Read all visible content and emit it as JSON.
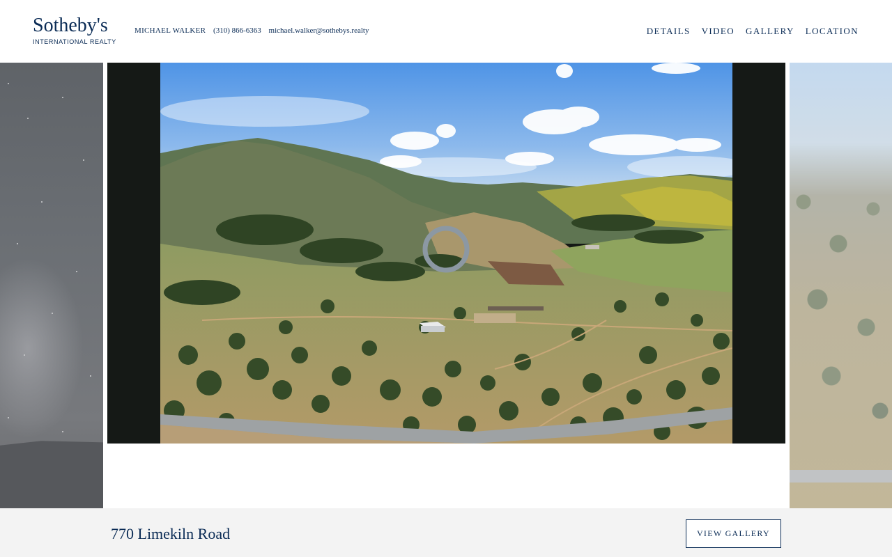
{
  "brand": {
    "name": "Sotheby's",
    "tagline": "INTERNATIONAL REALTY",
    "color": "#0a2b55"
  },
  "agent": {
    "name": "MICHAEL WALKER",
    "phone": "(310) 866-6363",
    "email": "michael.walker@sothebys.realty"
  },
  "nav": {
    "items": [
      {
        "label": "DETAILS"
      },
      {
        "label": "VIDEO"
      },
      {
        "label": "GALLERY"
      },
      {
        "label": "LOCATION"
      }
    ]
  },
  "listing": {
    "address": "770 Limekiln Road",
    "view_gallery_label": "VIEW GALLERY"
  }
}
